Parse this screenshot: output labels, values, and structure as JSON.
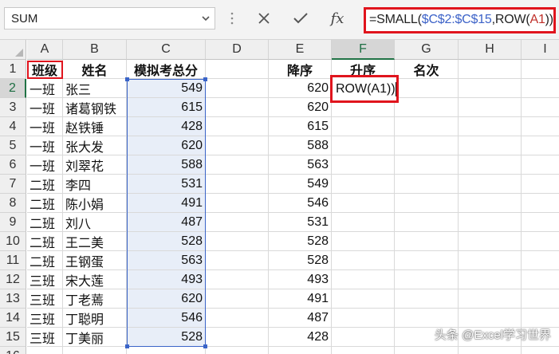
{
  "formula_bar": {
    "name_box": "SUM",
    "formula_prefix": "=SMALL(",
    "formula_range": "$C$2:$C$15",
    "formula_mid": ",ROW(",
    "formula_ref": "A1",
    "formula_suffix": "))"
  },
  "columns": [
    "A",
    "B",
    "C",
    "D",
    "E",
    "F",
    "G",
    "H",
    "I"
  ],
  "header_row": {
    "A": "班级",
    "B": "姓名",
    "C": "模拟考总分",
    "E": "降序",
    "F": "升序",
    "G": "名次"
  },
  "rows": [
    {
      "n": "1"
    },
    {
      "n": "2",
      "A": "一班",
      "B": "张三",
      "C": "549",
      "E": "620"
    },
    {
      "n": "3",
      "A": "一班",
      "B": "诸葛钢铁",
      "C": "615",
      "E": "620"
    },
    {
      "n": "4",
      "A": "一班",
      "B": "赵铁锤",
      "C": "428",
      "E": "615"
    },
    {
      "n": "5",
      "A": "一班",
      "B": "张大发",
      "C": "620",
      "E": "588"
    },
    {
      "n": "6",
      "A": "一班",
      "B": "刘翠花",
      "C": "588",
      "E": "563"
    },
    {
      "n": "7",
      "A": "二班",
      "B": "李四",
      "C": "531",
      "E": "549"
    },
    {
      "n": "8",
      "A": "二班",
      "B": "陈小娟",
      "C": "491",
      "E": "546"
    },
    {
      "n": "9",
      "A": "二班",
      "B": "刘八",
      "C": "487",
      "E": "531"
    },
    {
      "n": "10",
      "A": "二班",
      "B": "王二美",
      "C": "528",
      "E": "528"
    },
    {
      "n": "11",
      "A": "二班",
      "B": "王钢蛋",
      "C": "563",
      "E": "528"
    },
    {
      "n": "12",
      "A": "三班",
      "B": "宋大莲",
      "C": "493",
      "E": "493"
    },
    {
      "n": "13",
      "A": "三班",
      "B": "丁老蔫",
      "C": "620",
      "E": "491"
    },
    {
      "n": "14",
      "A": "三班",
      "B": "丁聪明",
      "C": "546",
      "E": "487"
    },
    {
      "n": "15",
      "A": "三班",
      "B": "丁美丽",
      "C": "528",
      "E": "428"
    },
    {
      "n": "16"
    }
  ],
  "editing_cell": {
    "address": "F2",
    "text": "ROW(A1))"
  },
  "watermark": "头条 @Excel学习世界",
  "colors": {
    "highlight_border": "#e0141d",
    "range_border": "#3a64c8",
    "range_fill": "#e8eef8",
    "excel_green": "#217346"
  }
}
